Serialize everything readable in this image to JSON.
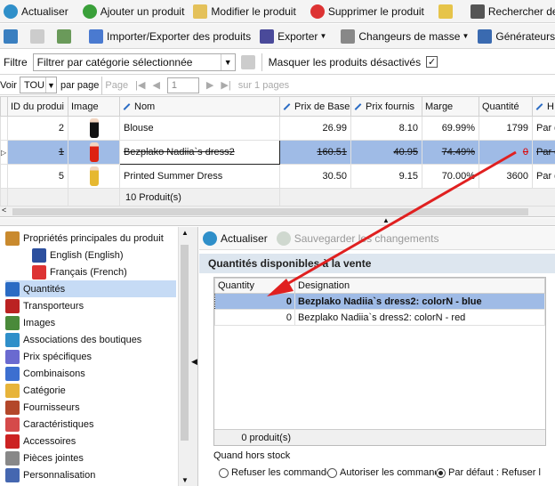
{
  "toolbar1": {
    "refresh": "Actualiser",
    "add": "Ajouter un produit",
    "edit": "Modifier le produit",
    "delete": "Supprimer le produit",
    "search": "Rechercher des p"
  },
  "toolbar2": {
    "import_export": "Importer/Exporter des produits",
    "export": "Exporter",
    "mass_changers": "Changeurs de masse",
    "generators": "Générateurs"
  },
  "filter": {
    "label": "Filtre",
    "value": "Filtrer par catégorie sélectionnée",
    "hide_disabled": "Masquer les produits désactivés",
    "hide_disabled_checked": "✓"
  },
  "pager": {
    "view": "Voir",
    "per_page_value": "TOU",
    "per_page": "par page",
    "page": "Page",
    "page_value": "1",
    "of": "sur 1 pages"
  },
  "grid": {
    "columns": [
      "ID du produi",
      "Image",
      "Nom",
      "Prix de Base",
      "Prix fournis",
      "Marge",
      "Quantité",
      "H"
    ],
    "rows": [
      {
        "id": "2",
        "name": "Blouse",
        "price": "26.99",
        "supplier": "8.10",
        "margin": "69.99%",
        "qty": "1799",
        "h": "Par d"
      },
      {
        "id": "1",
        "name": "Bezplako Nadiia`s dress2",
        "price": "160.51",
        "supplier": "40.95",
        "margin": "74.49%",
        "qty": "0",
        "h": "Par d"
      },
      {
        "id": "5",
        "name": "Printed Summer Dress",
        "price": "30.50",
        "supplier": "9.15",
        "margin": "70.00%",
        "qty": "3600",
        "h": "Par d"
      }
    ],
    "count": "10 Produit(s)"
  },
  "tree": {
    "items": [
      {
        "label": "Propriétés principales du produit",
        "icon": "box-icon",
        "color": "#c98a2e"
      },
      {
        "label": "English (English)",
        "icon": "flag-uk-icon",
        "color": "#2c4f9e"
      },
      {
        "label": "Français (French)",
        "icon": "flag-fr-icon",
        "color": "#d33"
      },
      {
        "label": "Quantités",
        "icon": "numbers-icon",
        "color": "#2a6bc4"
      },
      {
        "label": "Transporteurs",
        "icon": "truck-icon",
        "color": "#b22"
      },
      {
        "label": "Images",
        "icon": "image-icon",
        "color": "#4a8a3a"
      },
      {
        "label": "Associations des boutiques",
        "icon": "globe-icon",
        "color": "#2f8fc9"
      },
      {
        "label": "Prix spécifiques",
        "icon": "price-tag-icon",
        "color": "#6a6ad0"
      },
      {
        "label": "Combinaisons",
        "icon": "puzzle-icon",
        "color": "#3c6fd0"
      },
      {
        "label": "Catégorie",
        "icon": "folder-icon",
        "color": "#e7b43a"
      },
      {
        "label": "Fournisseurs",
        "icon": "supplier-icon",
        "color": "#b3472a"
      },
      {
        "label": "Caractéristiques",
        "icon": "features-icon",
        "color": "#d54a4a"
      },
      {
        "label": "Accessoires",
        "icon": "ribbon-icon",
        "color": "#c22"
      },
      {
        "label": "Pièces jointes",
        "icon": "attachment-icon",
        "color": "#888"
      },
      {
        "label": "Personnalisation",
        "icon": "customization-icon",
        "color": "#4567b0"
      }
    ]
  },
  "right": {
    "refresh": "Actualiser",
    "save": "Sauvegarder les changements",
    "title": "Quantités disponibles à la vente",
    "columns": [
      "Quantity",
      "Designation"
    ],
    "rows": [
      {
        "qty": "0",
        "designation": "Bezplako Nadiia`s dress2: colorN - blue"
      },
      {
        "qty": "0",
        "designation": "Bezplako Nadiia`s dress2: colorN - red"
      }
    ],
    "count": "0 produit(s)",
    "out_of_stock_label": "Quand hors stock",
    "options": [
      "Refuser les commande",
      "Autoriser les commande",
      "Par défaut : Refuser l"
    ]
  },
  "colors": {
    "selection": "#9fbbe6",
    "arrow": "#e02020",
    "header_bg": "#dde6ef"
  }
}
